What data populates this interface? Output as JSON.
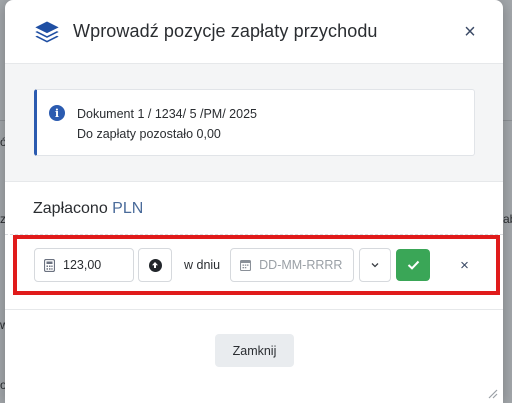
{
  "modal": {
    "title": "Wprowadź pozycje zapłaty przychodu",
    "close_label": "×",
    "info": {
      "line1": "Dokument 1 / 1234/ 5 /PM/ 2025",
      "line2_label": "Do zapłaty pozostało",
      "line2_value": "0,00"
    },
    "paid": {
      "label": "Zapłacono",
      "currency": "PLN"
    },
    "row": {
      "amount": "123,00",
      "on_day": "w dniu",
      "date_placeholder": "DD-MM-RRRR",
      "remove_label": "×"
    },
    "footer": {
      "close_button": "Zamknij"
    }
  },
  "background": {
    "frag_left_1": "ó",
    "frag_left_2": "z",
    "frag_right": "ab",
    "frag_left_3": "w",
    "frag_bottom": "onta"
  },
  "colors": {
    "accent": "#2b5bb0",
    "success": "#3aa657",
    "highlight": "#e01b1b"
  }
}
